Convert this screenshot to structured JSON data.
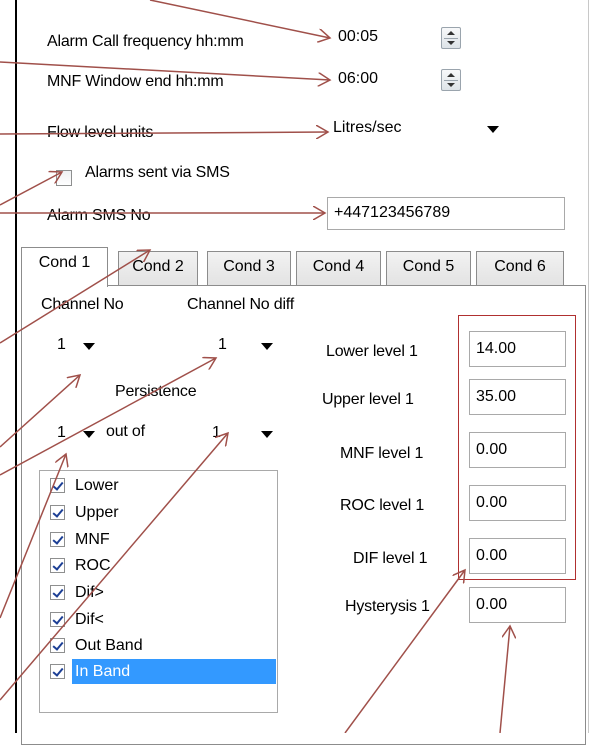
{
  "settings": {
    "alarm_call_freq_label": "Alarm Call frequency hh:mm",
    "alarm_call_freq_value": "00:05",
    "mnf_window_label": "MNF Window end hh:mm",
    "mnf_window_value": "06:00",
    "flow_units_label": "Flow level units",
    "flow_units_value": "Litres/sec",
    "alarms_sms_label": "Alarms sent via SMS",
    "alarms_sms_checked": false,
    "alarm_sms_no_label": "Alarm SMS No",
    "alarm_sms_no_value": "+447123456789"
  },
  "tabs": [
    {
      "label": "Cond 1",
      "active": true
    },
    {
      "label": "Cond 2",
      "active": false
    },
    {
      "label": "Cond 3",
      "active": false
    },
    {
      "label": "Cond 4",
      "active": false
    },
    {
      "label": "Cond 5",
      "active": false
    },
    {
      "label": "Cond 6",
      "active": false
    }
  ],
  "cond": {
    "channel_no_label": "Channel No",
    "channel_no_value": "1",
    "channel_no_diff_label": "Channel No diff",
    "channel_no_diff_value": "1",
    "persistence_label": "Persistence",
    "persistence_value": "1",
    "out_of_label": "out of",
    "out_of_value": "1",
    "levels": [
      {
        "label": "Lower level 1",
        "value": "14.00"
      },
      {
        "label": "Upper level 1",
        "value": "35.00"
      },
      {
        "label": "MNF level 1",
        "value": "0.00"
      },
      {
        "label": "ROC level 1",
        "value": "0.00"
      },
      {
        "label": "DIF level 1",
        "value": "0.00"
      },
      {
        "label": "Hysterysis 1",
        "value": "0.00"
      }
    ],
    "alarm_types": [
      {
        "label": "Lower",
        "checked": true,
        "selected": false
      },
      {
        "label": "Upper",
        "checked": true,
        "selected": false
      },
      {
        "label": "MNF",
        "checked": true,
        "selected": false
      },
      {
        "label": "ROC",
        "checked": true,
        "selected": false
      },
      {
        "label": "Dif>",
        "checked": true,
        "selected": false
      },
      {
        "label": "Dif<",
        "checked": true,
        "selected": false
      },
      {
        "label": "Out Band",
        "checked": true,
        "selected": false
      },
      {
        "label": "In Band",
        "checked": true,
        "selected": true
      }
    ]
  },
  "colors": {
    "annotation_arrow": "#a0504a",
    "selection": "#3399ff",
    "highlight_box": "#b03030"
  }
}
